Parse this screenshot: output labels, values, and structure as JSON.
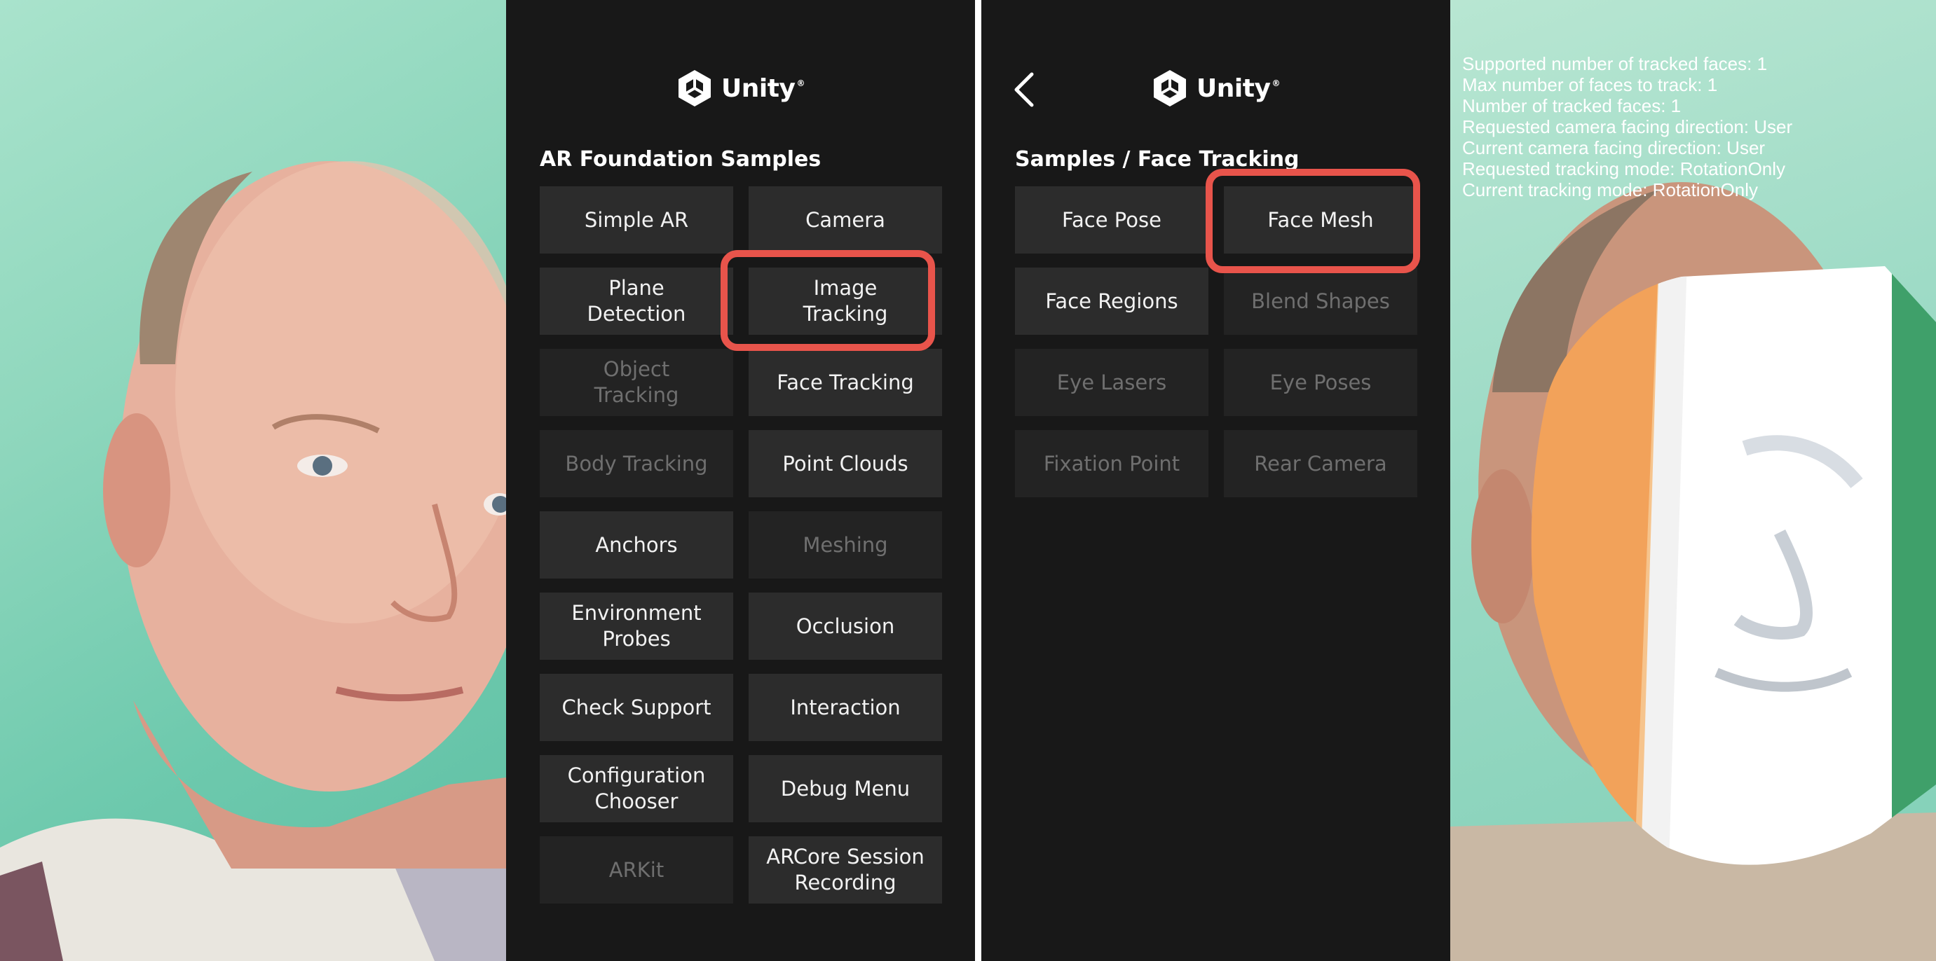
{
  "brand": {
    "name": "Unity",
    "trademark": "®"
  },
  "main_menu": {
    "title": "AR Foundation Samples",
    "buttons": [
      {
        "label": "Simple AR",
        "enabled": true
      },
      {
        "label": "Camera",
        "enabled": true
      },
      {
        "label": "Plane\nDetection",
        "enabled": true
      },
      {
        "label": "Image\nTracking",
        "enabled": true,
        "highlighted": true
      },
      {
        "label": "Object\nTracking",
        "enabled": false
      },
      {
        "label": "Face Tracking",
        "enabled": true
      },
      {
        "label": "Body Tracking",
        "enabled": false
      },
      {
        "label": "Point Clouds",
        "enabled": true
      },
      {
        "label": "Anchors",
        "enabled": true
      },
      {
        "label": "Meshing",
        "enabled": false
      },
      {
        "label": "Environment\nProbes",
        "enabled": true
      },
      {
        "label": "Occlusion",
        "enabled": true
      },
      {
        "label": "Check Support",
        "enabled": true
      },
      {
        "label": "Interaction",
        "enabled": true
      },
      {
        "label": "Configuration\nChooser",
        "enabled": true
      },
      {
        "label": "Debug Menu",
        "enabled": true
      },
      {
        "label": "ARKit",
        "enabled": false
      },
      {
        "label": "ARCore Session\nRecording",
        "enabled": true
      }
    ]
  },
  "face_menu": {
    "title": "Samples / Face Tracking",
    "buttons": [
      {
        "label": "Face Pose",
        "enabled": true
      },
      {
        "label": "Face Mesh",
        "enabled": true,
        "highlighted": true
      },
      {
        "label": "Face Regions",
        "enabled": true
      },
      {
        "label": "Blend Shapes",
        "enabled": false
      },
      {
        "label": "Eye Lasers",
        "enabled": false
      },
      {
        "label": "Eye Poses",
        "enabled": false
      },
      {
        "label": "Fixation Point",
        "enabled": false
      },
      {
        "label": "Rear Camera",
        "enabled": false
      }
    ]
  },
  "face_info": [
    "Supported number of tracked faces: 1",
    "Max number of faces to track: 1",
    "Number of tracked faces: 1",
    "Requested camera facing direction: User",
    "Current camera facing direction: User",
    "Requested tracking mode: RotationOnly",
    "Current tracking mode: RotationOnly"
  ],
  "colors": {
    "menu_background": "#181818",
    "button_background": "#2c2c2c",
    "button_text": "#f2f2f2",
    "disabled_text": "#6f6f6f",
    "highlight": "#e8544b",
    "flag_green": "#3fa06a",
    "flag_white": "#ffffff",
    "flag_orange": "#f2a25a"
  }
}
